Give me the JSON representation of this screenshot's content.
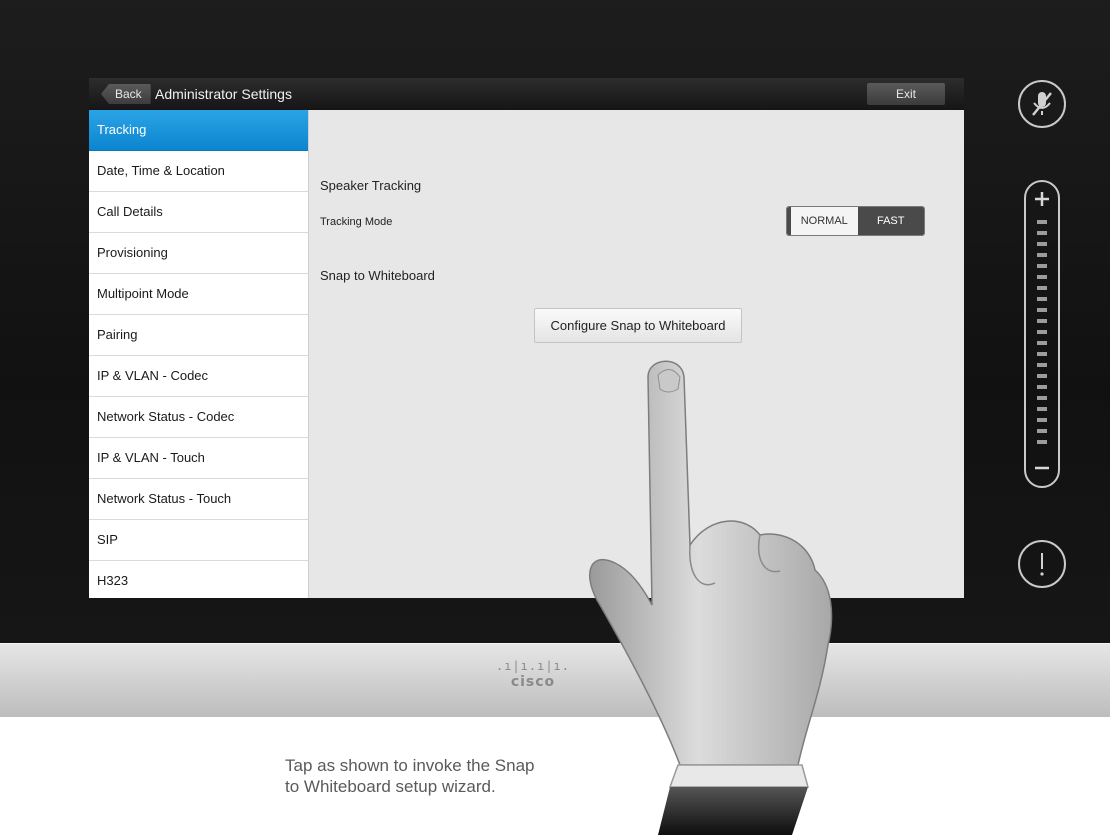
{
  "header": {
    "back_label": "Back",
    "title": "Administrator Settings",
    "exit_label": "Exit"
  },
  "sidebar": {
    "items": [
      {
        "label": "Tracking",
        "active": true
      },
      {
        "label": "Date, Time & Location"
      },
      {
        "label": "Call Details"
      },
      {
        "label": "Provisioning"
      },
      {
        "label": "Multipoint Mode"
      },
      {
        "label": "Pairing"
      },
      {
        "label": "IP & VLAN - Codec"
      },
      {
        "label": "Network Status - Codec"
      },
      {
        "label": "IP & VLAN - Touch"
      },
      {
        "label": "Network Status - Touch"
      },
      {
        "label": "SIP"
      },
      {
        "label": "H323"
      }
    ]
  },
  "content": {
    "speaker_tracking_heading": "Speaker Tracking",
    "tracking_mode_label": "Tracking Mode",
    "tracking_mode_options": [
      "NORMAL",
      "FAST"
    ],
    "tracking_mode_selected": "NORMAL",
    "snap_heading": "Snap to Whiteboard",
    "configure_button": "Configure Snap to Whiteboard"
  },
  "brand": {
    "logo_bars": ".ı|ı.ı|ı.",
    "logo_text": "cisco"
  },
  "caption": {
    "line1": "Tap as shown to invoke the Snap",
    "line2": "to Whiteboard setup wizard."
  },
  "colors": {
    "accent": "#1996dc",
    "toggle_selected": "#4a4a4a",
    "bezel": "#151515"
  },
  "icons": {
    "mute": "microphone-muted-icon",
    "volume_up": "plus-icon",
    "volume_down": "minus-icon",
    "alert": "exclamation-icon",
    "back": "back-arrow-icon"
  }
}
